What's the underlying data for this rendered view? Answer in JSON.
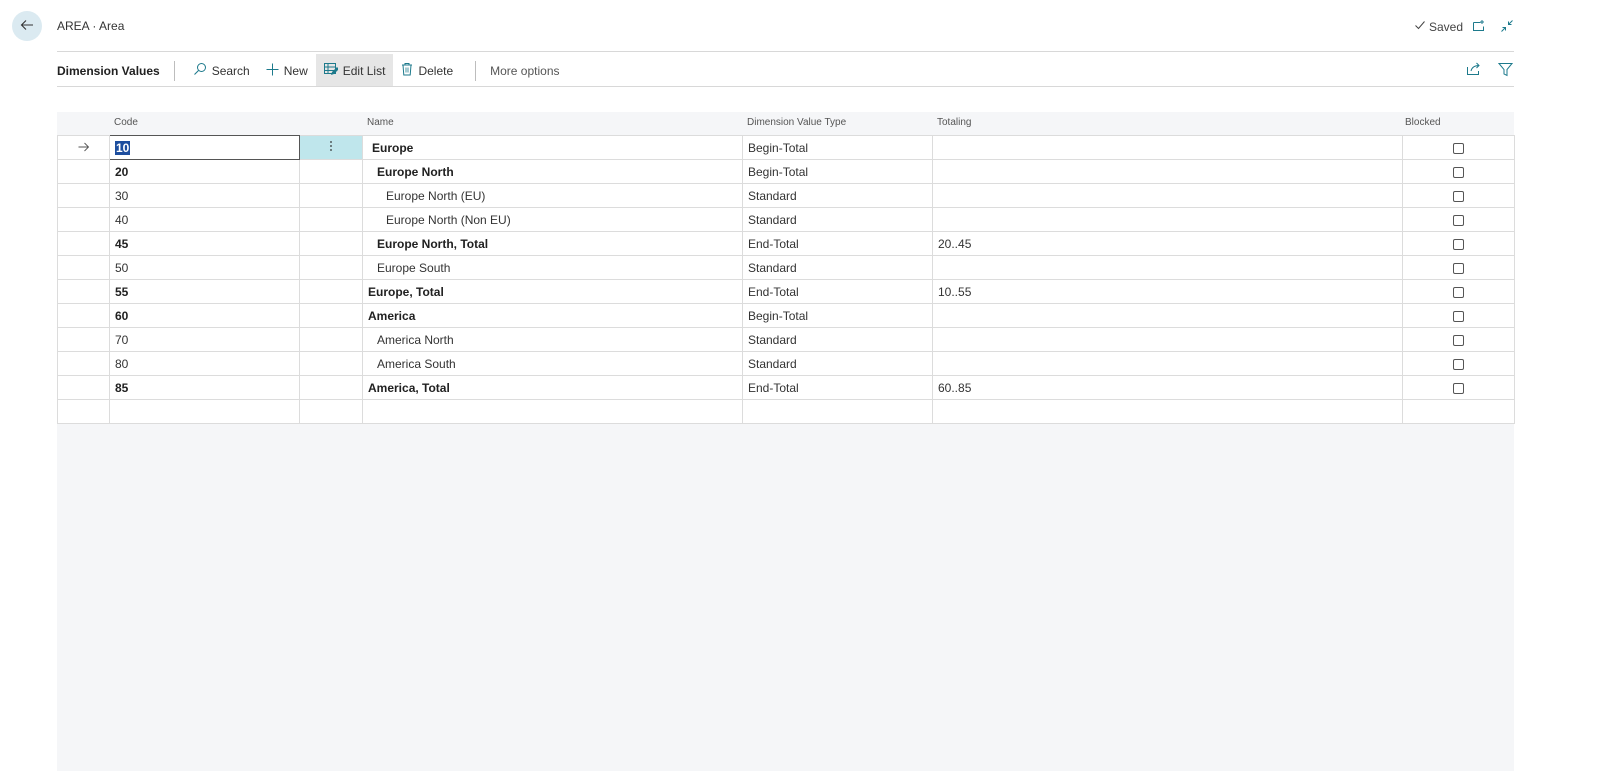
{
  "header": {
    "title": "AREA · Area",
    "status": "Saved"
  },
  "actionbar": {
    "title": "Dimension Values",
    "search": "Search",
    "new": "New",
    "edit_list": "Edit List",
    "delete": "Delete",
    "more": "More options"
  },
  "grid": {
    "columns": {
      "code": "Code",
      "name": "Name",
      "type": "Dimension Value Type",
      "totaling": "Totaling",
      "blocked": "Blocked"
    },
    "rows": [
      {
        "code": "10",
        "name": "Europe",
        "type": "Begin-Total",
        "totaling": "",
        "blocked": false,
        "bold": true,
        "indent": 1,
        "selected": true
      },
      {
        "code": "20",
        "name": "Europe North",
        "type": "Begin-Total",
        "totaling": "",
        "blocked": false,
        "bold": true,
        "indent": 2
      },
      {
        "code": "30",
        "name": "Europe North (EU)",
        "type": "Standard",
        "totaling": "",
        "blocked": false,
        "bold": false,
        "indent": 3
      },
      {
        "code": "40",
        "name": "Europe North (Non EU)",
        "type": "Standard",
        "totaling": "",
        "blocked": false,
        "bold": false,
        "indent": 3
      },
      {
        "code": "45",
        "name": "Europe North, Total",
        "type": "End-Total",
        "totaling": "20..45",
        "blocked": false,
        "bold": true,
        "indent": 2
      },
      {
        "code": "50",
        "name": "Europe South",
        "type": "Standard",
        "totaling": "",
        "blocked": false,
        "bold": false,
        "indent": 2
      },
      {
        "code": "55",
        "name": "Europe, Total",
        "type": "End-Total",
        "totaling": "10..55",
        "blocked": false,
        "bold": true,
        "indent": 0
      },
      {
        "code": "60",
        "name": "America",
        "type": "Begin-Total",
        "totaling": "",
        "blocked": false,
        "bold": true,
        "indent": 0
      },
      {
        "code": "70",
        "name": "America North",
        "type": "Standard",
        "totaling": "",
        "blocked": false,
        "bold": false,
        "indent": 2
      },
      {
        "code": "80",
        "name": "America South",
        "type": "Standard",
        "totaling": "",
        "blocked": false,
        "bold": false,
        "indent": 2
      },
      {
        "code": "85",
        "name": "America, Total",
        "type": "End-Total",
        "totaling": "60..85",
        "blocked": false,
        "bold": true,
        "indent": 0
      }
    ]
  },
  "colors": {
    "accent": "#1d7a8c",
    "selection": "#1d4e9e",
    "back_button_bg": "#dbeaf1",
    "menu_cell_bg": "#bfe6ec"
  }
}
